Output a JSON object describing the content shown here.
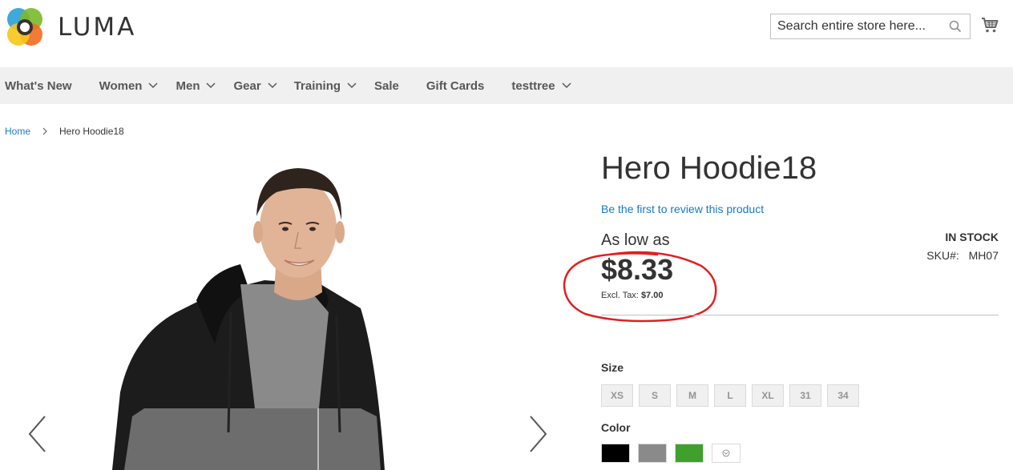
{
  "brand": {
    "name": "LUMA"
  },
  "search": {
    "placeholder": "Search entire store here..."
  },
  "icons": {
    "search": "search-icon",
    "cart": "cart-icon",
    "chevron": "chevron-down-icon",
    "prev": "chevron-left-icon",
    "next": "chevron-right-icon"
  },
  "nav": {
    "items": [
      {
        "label": "What's New",
        "has_dropdown": false
      },
      {
        "label": "Women",
        "has_dropdown": true
      },
      {
        "label": "Men",
        "has_dropdown": true
      },
      {
        "label": "Gear",
        "has_dropdown": true
      },
      {
        "label": "Training",
        "has_dropdown": true
      },
      {
        "label": "Sale",
        "has_dropdown": false
      },
      {
        "label": "Gift Cards",
        "has_dropdown": false
      },
      {
        "label": "testtree",
        "has_dropdown": true
      }
    ]
  },
  "breadcrumb": {
    "home": "Home",
    "current": "Hero Hoodie18"
  },
  "product": {
    "title": "Hero Hoodie18",
    "review_link": "Be the first to review this product",
    "as_low_as": "As low as",
    "price": "$8.33",
    "excl_tax_label": "Excl. Tax:",
    "excl_tax_value": "$7.00",
    "stock": "IN STOCK",
    "sku_label": "SKU#:",
    "sku_value": "MH07"
  },
  "options": {
    "size_label": "Size",
    "sizes": [
      "XS",
      "S",
      "M",
      "L",
      "XL",
      "31",
      "34"
    ],
    "color_label": "Color",
    "colors": [
      "#000000",
      "#8a8a8a",
      "#3fa12b"
    ]
  },
  "colors": {
    "accent_link": "#1979c3",
    "nav_bg": "#f0f0f0",
    "annotation": "#e02020"
  }
}
